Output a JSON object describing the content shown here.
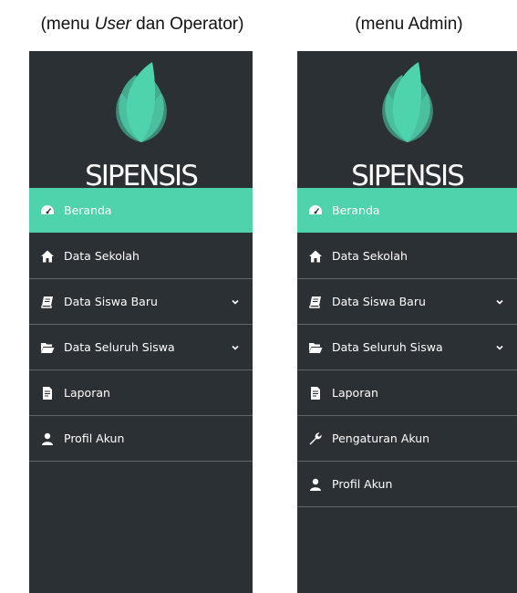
{
  "captions": {
    "left_prefix": "(menu ",
    "left_italic": "User",
    "left_suffix": " dan Operator)",
    "right": "(menu Admin)"
  },
  "brand": "SIPENSIS",
  "colors": {
    "sidebar_bg": "#2b3035",
    "accent": "#4fd3ad",
    "divider": "#5f656b",
    "text": "#ffffff"
  },
  "user_menu": [
    {
      "label": "Beranda",
      "icon": "dashboard-icon",
      "active": true
    },
    {
      "label": "Data Sekolah",
      "icon": "home-icon"
    },
    {
      "label": "Data Siswa Baru",
      "icon": "book-icon",
      "has_submenu": true
    },
    {
      "label": "Data Seluruh Siswa",
      "icon": "folder-open-icon",
      "has_submenu": true
    },
    {
      "label": "Laporan",
      "icon": "file-text-icon"
    },
    {
      "label": "Profil Akun",
      "icon": "user-icon"
    }
  ],
  "admin_menu": [
    {
      "label": "Beranda",
      "icon": "dashboard-icon",
      "active": true
    },
    {
      "label": "Data Sekolah",
      "icon": "home-icon"
    },
    {
      "label": "Data Siswa Baru",
      "icon": "book-icon",
      "has_submenu": true
    },
    {
      "label": "Data Seluruh Siswa",
      "icon": "folder-open-icon",
      "has_submenu": true
    },
    {
      "label": "Laporan",
      "icon": "file-text-icon"
    },
    {
      "label": "Pengaturan Akun",
      "icon": "wrench-icon"
    },
    {
      "label": "Profil Akun",
      "icon": "user-icon"
    }
  ]
}
